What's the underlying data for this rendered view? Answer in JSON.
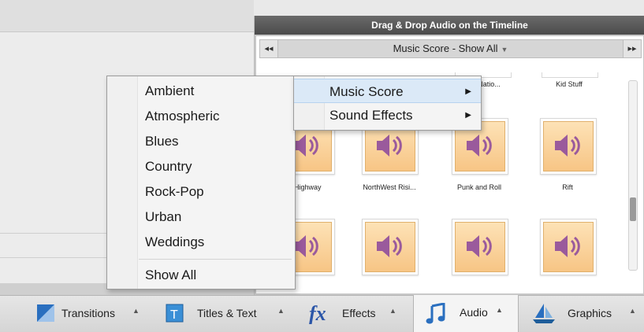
{
  "panel": {
    "title": "Drag & Drop Audio on the Timeline"
  },
  "nav": {
    "prev": "◂◂",
    "next": "▸▸",
    "category": "Music Score - Show All"
  },
  "top_labels": [
    "...al Natio...",
    "Kid Stuff"
  ],
  "tiles_row1_labels": [
    "...t Highway",
    "NorthWest Risi...",
    "Punk and Roll",
    "Rift"
  ],
  "menu_primary": {
    "items": [
      "Music Score",
      "Sound Effects"
    ]
  },
  "menu_genres": {
    "items": [
      "Ambient",
      "Atmospheric",
      "Blues",
      "Country",
      "Rock-Pop",
      "Urban",
      "Weddings"
    ],
    "show_all": "Show All"
  },
  "tabs": [
    {
      "label": "Transitions",
      "icon": "transitions-icon"
    },
    {
      "label": "Titles & Text",
      "icon": "titles-text-icon"
    },
    {
      "label": "Effects",
      "icon": "fx-icon"
    },
    {
      "label": "Audio",
      "icon": "music-note-icon"
    },
    {
      "label": "Graphics",
      "icon": "sailboat-icon"
    }
  ],
  "colors": {
    "accent_blue": "#2a6fbf",
    "tile_orange": "#f7c585",
    "speaker_purple": "#9a5a9c"
  }
}
